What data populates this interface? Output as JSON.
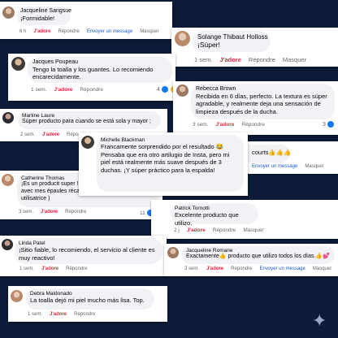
{
  "labels": {
    "like": "J'adore",
    "reply": "Répondre",
    "send_message": "Envoyer un message",
    "hide": "Masquer"
  },
  "comments": [
    {
      "name": "Jacqueline Sangsue",
      "text": "¡Formidable!",
      "time": "6 h"
    },
    {
      "name": "Solange Thibaut Holloss",
      "text": "¡Súper!",
      "time": "1 sem."
    },
    {
      "name": "Jacques Poupeau",
      "text": "Tengo la toalla y los guantes. Lo recomiendo encarecidamente.",
      "time": "1 sem.",
      "reactions": "4"
    },
    {
      "name": "Rebecca Brown",
      "text": "Recibida en 6 días, perfecto. La textura es súper agradable, y realmente deja una sensación de limpieza después de la ducha.",
      "time": "3 sem.",
      "reactions": "3"
    },
    {
      "name": "Martine Laure",
      "text": "Súper producto para cuando se está sola y mayor ;",
      "time": "2 sem."
    },
    {
      "name": "Michelle Blackman",
      "text": "Francamente sorprendido por el resultado 😂 Pensaba que era otro artilugio de Insta, pero mi piel está realmente más suave después de 3 duchas. ¡Y súper práctico para la espalda!"
    },
    {
      "name": "",
      "text": "courts👍👍👍",
      "time": "",
      "partial": true
    },
    {
      "name": "Catherine Thomas",
      "text": "¡Es un producit super ! ..... pour ceux qui ont un fan avec mes épaules récalcitrantes !! ( je suis une vraie utilisatrice )",
      "time": "3 sem.",
      "reactions": "11"
    },
    {
      "name": "Patrick Tornotti",
      "text": "Excelente producto que utilizo.",
      "time": "2 j"
    },
    {
      "name": "Linda Patel",
      "text": "¡Sitio fiable, lo recomiendo, el servicio al cliente es muy reactivo!",
      "time": "1 sem."
    },
    {
      "name": "Jacqueline Romane",
      "text": "Exactamente👍 producto que utilizo todos los días.👍💕",
      "time": "3 sem."
    },
    {
      "name": "Debra Maldonado",
      "text": "La toalla dejó mi piel mucho más lisa. Top.",
      "time": "1 sem."
    }
  ]
}
